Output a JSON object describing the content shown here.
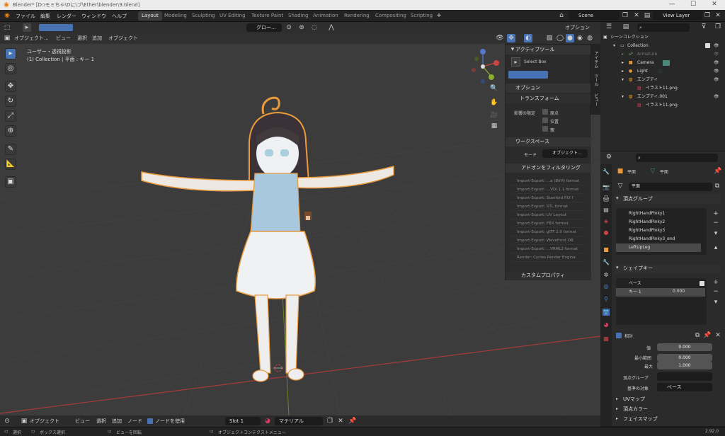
{
  "titlebar": {
    "text": "Blender* [D:\\モミちゃ\\Dに\\ブ\\Ether\\blender\\9.blend]"
  },
  "menus": [
    "ファイル",
    "編集",
    "レンダー",
    "ウィンドウ",
    "ヘルプ"
  ],
  "workspaces": [
    "Layout",
    "Modeling",
    "Sculpting",
    "UV Editing",
    "Texture Paint",
    "Shading",
    "Animation",
    "Rendering",
    "Compositing",
    "Scripting"
  ],
  "active_workspace": "Layout",
  "scene": "Scene",
  "view_layer": "View Layer",
  "viewport": {
    "mode": "オブジェクト...",
    "menus": [
      "ビュー",
      "選択",
      "追加",
      "オブジェクト"
    ],
    "orientation": "グロー...",
    "overlay_label": "オプション",
    "info_line1": "ユーザー・透視投影",
    "info_line2": "(1) Collection | 平面 : キー 1"
  },
  "npanel": {
    "active_tool_header": "アクティブツール",
    "select_box": "Select Box",
    "options_header": "オプション",
    "transform_header": "トランスフォーム",
    "affect_only": "影響の限定",
    "check_origin": "原点",
    "check_location": "位置",
    "check_parent": "親",
    "workspace_header": "ワークスペース",
    "mode_label": "モード",
    "mode_value": "オブジェクト...",
    "addon_filter": "アドオンをフィルタリング",
    "addons": [
      "Import-Export: ...a (BVH) format",
      "Import-Export: ...VOI 1.1 format",
      "Import-Export: Stanford PLY f",
      "Import-Export: STL format",
      "Import-Export: UV Layout",
      "Import-Export: FBX format",
      "Import-Export: glTF 2.0 format",
      "Import-Export: Wavefront OB",
      "Import-Export: ...VRML2 format",
      "Render: Cycles Render Engine"
    ],
    "custom_props": "カスタムプロパティ",
    "tabs": [
      "アイテム",
      "ツール",
      "ビュー"
    ]
  },
  "outliner": {
    "root": "シーンコレクション",
    "rows": [
      "Collection",
      "Armature",
      "Camera",
      "Light",
      "エンプティ",
      "イラスト11.png",
      "エンプティ.001",
      "イラスト11.png"
    ]
  },
  "properties": {
    "search_placeholder": "",
    "object_name": "平面",
    "data_name": "平面",
    "mesh_field": "平面",
    "vertex_groups_header": "頂点グループ",
    "vertex_groups": [
      "RightHandPinky1",
      "RightHandPinky2",
      "RightHandPinky3",
      "RightHandPinky3_end",
      "LeftUpLeg"
    ],
    "shape_keys_header": "シェイプキー",
    "shape_keys": [
      "ベース",
      "キー 1"
    ],
    "shape_key_value_inline": "0.000",
    "relative_label": "相対",
    "value_label": "値",
    "value": "0.000",
    "range_min_label": "最小範囲",
    "range_min": "0.000",
    "range_max_label": "最大",
    "range_max": "1.000",
    "vgroup_label": "頂点グループ",
    "relative_to_label": "基準の対象",
    "relative_to_value": "ベース",
    "uv_maps": "UVマップ",
    "vertex_colors": "頂点カラー",
    "face_maps": "フェイスマップ"
  },
  "bottom": {
    "mode": "オブジェクト",
    "menus": [
      "ビュー",
      "選択",
      "追加",
      "ノード"
    ],
    "use_nodes": "ノードを使用",
    "slot": "Slot 1",
    "material": "マテリアル"
  },
  "status": {
    "select": "選択",
    "box_select": "ボックス選択",
    "rotate_view": "ビューを回転",
    "context_menu": "オブジェクトコンテクストメニュー",
    "version": "2.92.0"
  },
  "colors": {
    "accent": "#4772b3",
    "selection_outline": "#e89a3c",
    "xaxis": "#a83a3a",
    "yaxis": "#7a9a2a"
  }
}
